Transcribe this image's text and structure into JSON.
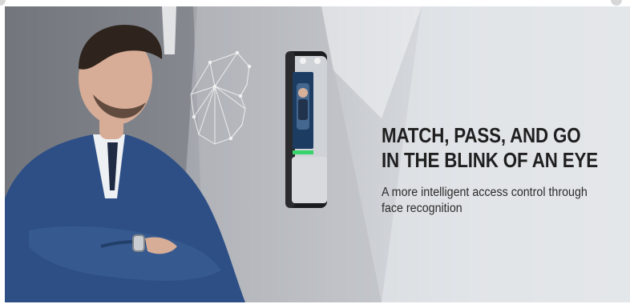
{
  "banner": {
    "headline_line1": "MATCH, PASS, AND GO",
    "headline_line2": "IN THE BLINK OF AN EYE",
    "subhead_line1": "A more intelligent access control through",
    "subhead_line2": "face recognition"
  },
  "colors": {
    "headline": "#1f1f1f",
    "suit": "#2d4f86",
    "device_body": "#cfd2d6",
    "device_indicator": "#37d36b"
  },
  "icons": [
    "face-wireframe-icon"
  ]
}
